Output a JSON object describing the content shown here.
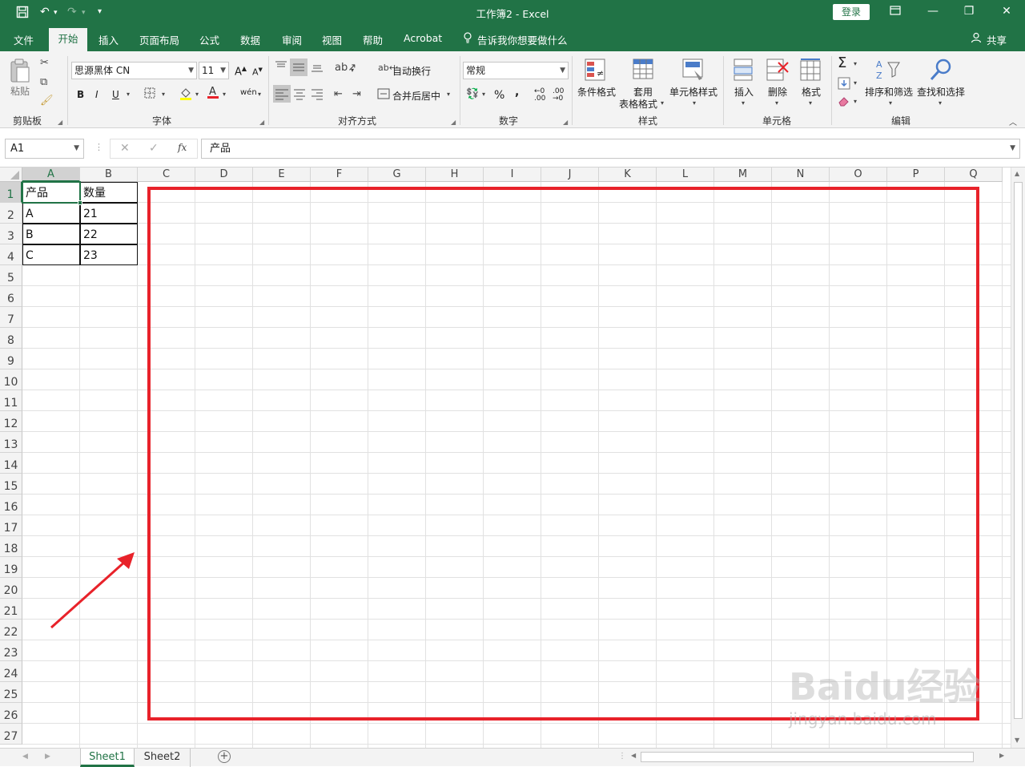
{
  "titlebar": {
    "title": "工作簿2  -  Excel",
    "login": "登录",
    "qat": {
      "save_icon": "save-icon",
      "undo_icon": "undo-icon",
      "redo_icon": "redo-icon"
    }
  },
  "tabs": [
    "文件",
    "开始",
    "插入",
    "页面布局",
    "公式",
    "数据",
    "审阅",
    "视图",
    "帮助",
    "Acrobat"
  ],
  "active_tab": "开始",
  "tellme": "告诉我你想要做什么",
  "share": "共享",
  "ribbon": {
    "clipboard": {
      "paste": "粘贴",
      "label": "剪贴板"
    },
    "font": {
      "name": "思源黑体 CN",
      "size": "11",
      "bold": "B",
      "italic": "I",
      "underline": "U",
      "label": "字体"
    },
    "alignment": {
      "wrap": "自动换行",
      "merge": "合并后居中",
      "label": "对齐方式"
    },
    "number": {
      "format": "常规",
      "percent": "%",
      "comma": ",",
      "label": "数字"
    },
    "styles": {
      "conditional": "条件格式",
      "table_line1": "套用",
      "table_line2": "表格格式",
      "cell_styles": "单元格样式",
      "label": "样式"
    },
    "cells": {
      "insert": "插入",
      "delete": "删除",
      "format": "格式",
      "label": "单元格"
    },
    "editing": {
      "sort": "排序和筛选",
      "find": "查找和选择",
      "label": "编辑"
    }
  },
  "formula_bar": {
    "name_box": "A1",
    "fx": "fx",
    "content": "产品"
  },
  "columns": [
    "A",
    "B",
    "C",
    "D",
    "E",
    "F",
    "G",
    "H",
    "I",
    "J",
    "K",
    "L",
    "M",
    "N",
    "O",
    "P",
    "Q"
  ],
  "rows": [
    "1",
    "2",
    "3",
    "4",
    "5",
    "6",
    "7",
    "8",
    "9",
    "10",
    "11",
    "12",
    "13",
    "14",
    "15",
    "16",
    "17",
    "18",
    "19",
    "20",
    "21",
    "22",
    "23",
    "24",
    "25",
    "26",
    "27"
  ],
  "cells": [
    [
      "产品",
      "数量"
    ],
    [
      "A",
      "21"
    ],
    [
      "B",
      "22"
    ],
    [
      "C",
      "23"
    ]
  ],
  "sheets": [
    "Sheet1",
    "Sheet2"
  ],
  "active_sheet": "Sheet1",
  "watermark": {
    "brand": "Baidu经验",
    "url": "jingyan.baidu.com"
  },
  "colors": {
    "excel_green": "#217346",
    "annotation_red": "#e8222a"
  }
}
